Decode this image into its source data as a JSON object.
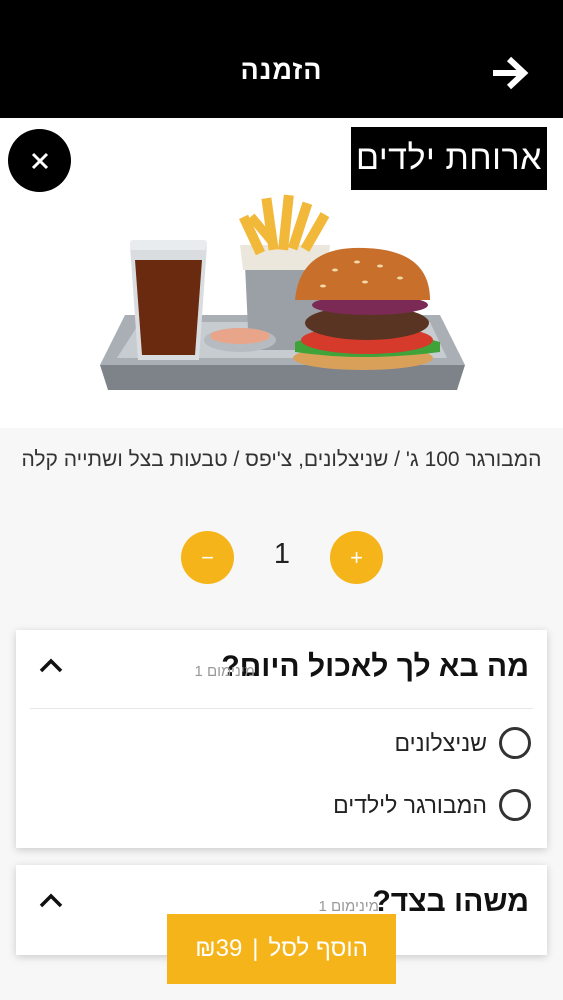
{
  "header": {
    "title": "הזמנה",
    "back_icon": "arrow-right-icon"
  },
  "product": {
    "name": "ארוחת ילדים",
    "description": "המבורגר 100 ג' / שניצלונים, צ'יפס / טבעות בצל ושתייה קלה",
    "image": "kids-meal-tray-image",
    "close_icon": "close-icon"
  },
  "quantity": {
    "value": "1",
    "minus": "−",
    "plus": "+"
  },
  "sections": [
    {
      "title": "מה בא לך לאכול היום?",
      "min_label": "מינימום 1",
      "options": [
        {
          "label": "שניצלונים",
          "selected": false
        },
        {
          "label": "המבורגר לילדים",
          "selected": false
        }
      ]
    },
    {
      "title": "משהו בצד?",
      "min_label": "מינימום 1"
    }
  ],
  "cart": {
    "price": "₪39",
    "separator": "|",
    "label": "הוסף לסל"
  },
  "colors": {
    "accent": "#f5b41a",
    "header_bg": "#000000"
  }
}
